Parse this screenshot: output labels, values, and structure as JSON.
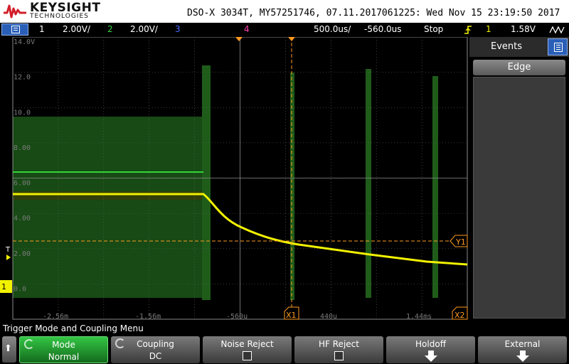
{
  "brand": {
    "name": "KEYSIGHT",
    "sub": "TECHNOLOGIES"
  },
  "title": "DSO-X 3034T, MY57251746, 07.11.2017061225: Wed Nov 15 23:19:50 2017",
  "status": {
    "ch1_num": "1",
    "ch1_scale": "2.00V/",
    "ch2_num": "2",
    "ch2_scale": "2.00V/",
    "ch3_num": "3",
    "ch4_num": "4",
    "timebase": "500.0us/",
    "delay": "-560.0us",
    "run_state": "Stop",
    "trigger_src": "1",
    "trigger_level": "1.58V"
  },
  "y_axis_labels": [
    "14.0V",
    "12.0",
    "10.0",
    "8.00",
    "6.00",
    "4.00",
    "2.00",
    "0.0"
  ],
  "x_axis_labels": [
    "-2.56m",
    "-1.56m",
    "-560u",
    "440u",
    "1.44ms"
  ],
  "markers": {
    "x1": "X1",
    "x2": "X2",
    "y1": "Y1",
    "trigger": "T",
    "ch1_ground": "1"
  },
  "side_panel": {
    "header": "Events",
    "tab": "Edge"
  },
  "menu_title": "Trigger Mode and Coupling Menu",
  "softkeys": [
    {
      "line1": "Mode",
      "line2": "Normal"
    },
    {
      "line1": "Coupling",
      "line2": "DC"
    },
    {
      "line1": "Noise Reject",
      "line2": ""
    },
    {
      "line1": "HF Reject",
      "line2": ""
    },
    {
      "line1": "Holdoff",
      "line2": ""
    },
    {
      "line1": "External",
      "line2": ""
    }
  ],
  "colors": {
    "ch1": "#f2f200",
    "ch2": "#33d43a",
    "ch3": "#4a6cff",
    "ch4": "#ff3fb0",
    "cursor": "#ff9a1f",
    "trigger": "#ff9a1f",
    "grid": "#6a6a6a"
  },
  "icons": [
    "menu-icon",
    "trigger-edge-icon",
    "waveform-icon",
    "events-list-icon",
    "back-arrow-icon",
    "down-arrow-icon"
  ]
}
